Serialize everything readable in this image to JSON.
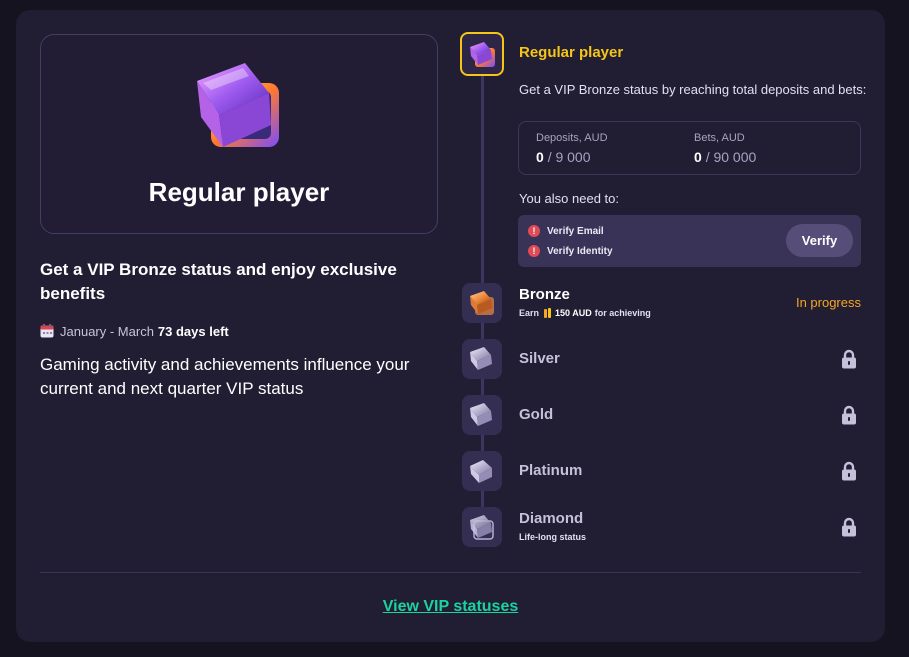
{
  "hero": {
    "title": "Regular player"
  },
  "headline": "Get a VIP Bronze status and enjoy exclusive benefits",
  "period": {
    "range": "January - March",
    "days_left": "73 days left"
  },
  "activity_text": "Gaming activity and achievements influence your current and next quarter VIP status",
  "current_level": {
    "title": "Regular player",
    "requirement": "Get a VIP Bronze status by reaching total deposits and bets:",
    "deposits": {
      "label": "Deposits, AUD",
      "current": "0",
      "target": "/ 9 000"
    },
    "bets": {
      "label": "Bets, AUD",
      "current": "0",
      "target": "/ 90 000"
    },
    "also_need": "You also need to:",
    "verifications": [
      "Verify Email",
      "Verify Identity"
    ],
    "verify_button": "Verify"
  },
  "levels": [
    {
      "name": "Bronze",
      "sub_prefix": "Earn",
      "sub_amount": "150 AUD",
      "sub_suffix": "for achieving",
      "status": "In progress"
    },
    {
      "name": "Silver",
      "status_icon": "lock-icon"
    },
    {
      "name": "Gold",
      "status_icon": "lock-icon"
    },
    {
      "name": "Platinum",
      "status_icon": "lock-icon"
    },
    {
      "name": "Diamond",
      "sub_text": "Life-long status",
      "status_icon": "lock-icon"
    }
  ],
  "footer": {
    "link": "View VIP statuses"
  },
  "colors": {
    "accent_yellow": "#f5c518",
    "progress_orange": "#f5a623",
    "link_green": "#19d49f",
    "card_bg": "#211d33"
  }
}
